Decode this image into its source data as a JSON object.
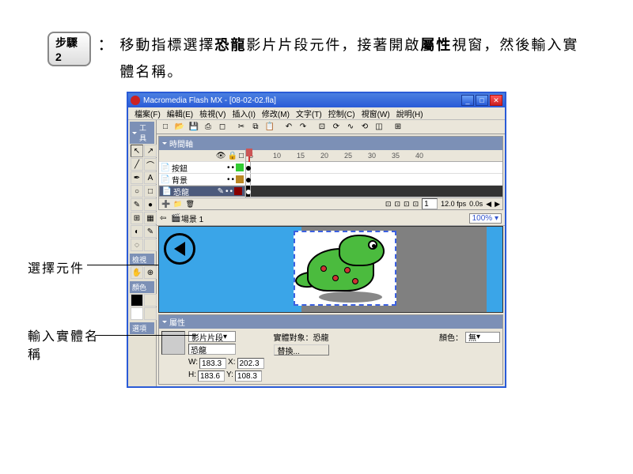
{
  "step": {
    "badge": "步驟 2",
    "instr_pre": "移動指標選擇",
    "instr_b1": "恐龍",
    "instr_mid": "影片片段元件，接著開啟",
    "instr_b2": "屬性",
    "instr_post": "視窗，然後輸入實體名稱。"
  },
  "annotations": {
    "select_obj": "選擇元件",
    "enter_name": "輸入實體名稱"
  },
  "win": {
    "title": "Macromedia Flash MX - [08-02-02.fla]",
    "menu": [
      "檔案(F)",
      "編輯(E)",
      "檢視(V)",
      "插入(I)",
      "修改(M)",
      "文字(T)",
      "控制(C)",
      "視窗(W)",
      "說明(H)"
    ],
    "window_controls": [
      "_",
      "□",
      "✕"
    ]
  },
  "panels": {
    "tools": "工具",
    "timeline": "時間軸",
    "view": "檢視",
    "colors": "顏色",
    "options": "選項",
    "props": "屬性"
  },
  "layers": {
    "l1": "按鈕",
    "l2": "背景",
    "l3": "恐龍"
  },
  "ruler": [
    "5",
    "10",
    "15",
    "20",
    "25",
    "30",
    "35",
    "40"
  ],
  "timeline_status": {
    "frame": "1",
    "fps": "12.0 fps",
    "time": "0.0s"
  },
  "scene": {
    "label": "場景 1",
    "zoom": "100%"
  },
  "properties": {
    "type": "影片片段",
    "instance_name": "恐龍",
    "target_label": "實體對象：",
    "target_value": "恐龍",
    "swap": "替換...",
    "color_label": "顏色：",
    "color_value": "無",
    "W": "183.3",
    "X": "202.3",
    "H": "183.6",
    "Y": "108.3",
    "w_lbl": "W:",
    "h_lbl": "H:",
    "x_lbl": "X:",
    "y_lbl": "Y:"
  },
  "tool_icons": {
    "arrow": "↖",
    "sub": "↗",
    "line": "╱",
    "lasso": "⌒",
    "pen": "✒",
    "text": "A",
    "oval": "○",
    "rect": "□",
    "pencil": "✎",
    "brush": "●",
    "trans": "⊞",
    "fill": "▦",
    "ink": "◐",
    "eyedrop": "✎",
    "eraser": "◌",
    "hand": "✋",
    "zoom": "⊕"
  },
  "toolbar_icons": {
    "new": "□",
    "open": "📂",
    "save": "💾",
    "print": "⎙",
    "preview": "◻",
    "cut": "✂",
    "copy": "⧉",
    "paste": "📋",
    "undo": "↶",
    "redo": "↷",
    "snap": "⊡",
    "smooth": "⟳",
    "straight": "∿",
    "rotate": "⟲",
    "scale": "◫",
    "align": "⊞"
  }
}
